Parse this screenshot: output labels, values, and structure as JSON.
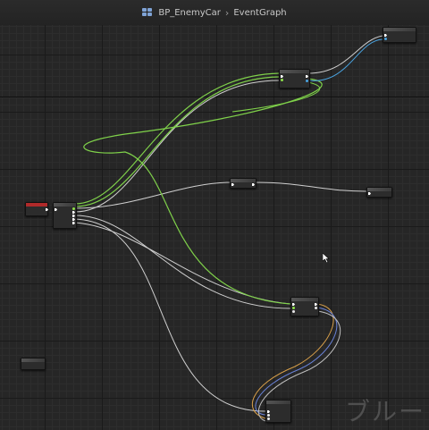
{
  "breadcrumb": {
    "blueprint": "BP_EnemyCar",
    "separator": "›",
    "graph": "EventGraph"
  },
  "watermark": "ブルー",
  "colors": {
    "background": "#262626",
    "wire_exec": "#e8e8e8",
    "wire_object": "#7fd14a",
    "wire_blue": "#49a3e0",
    "wire_orange": "#d9a04a",
    "event_header": "#b02a2a"
  },
  "nodes": [
    {
      "id": "event",
      "kind": "event"
    },
    {
      "id": "sequence",
      "kind": "function"
    },
    {
      "id": "top",
      "kind": "function"
    },
    {
      "id": "set",
      "kind": "function"
    },
    {
      "id": "mid",
      "kind": "function"
    },
    {
      "id": "right",
      "kind": "function"
    },
    {
      "id": "lower",
      "kind": "function"
    },
    {
      "id": "bottom",
      "kind": "function"
    },
    {
      "id": "lone",
      "kind": "function"
    }
  ]
}
